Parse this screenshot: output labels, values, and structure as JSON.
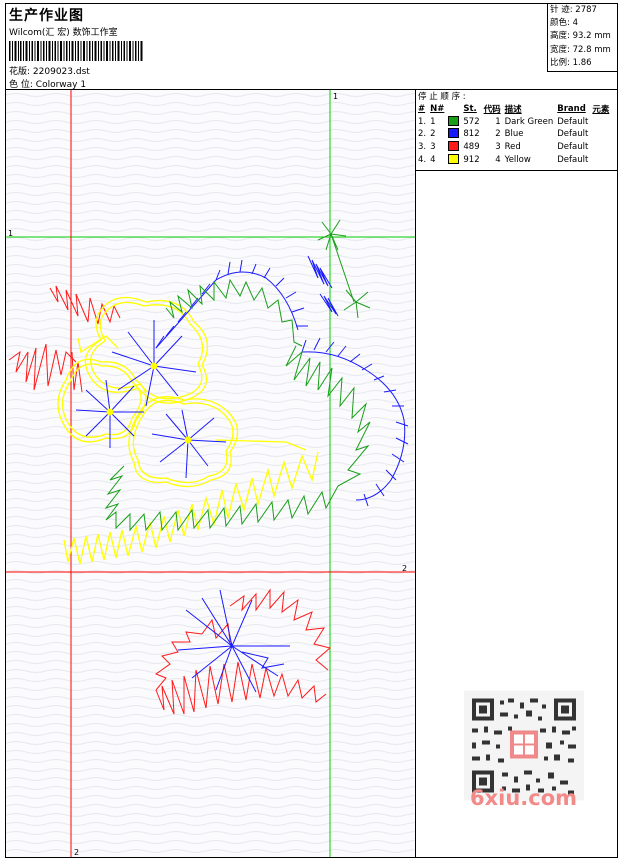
{
  "header": {
    "title": "生产作业图",
    "company": "Wilcom(汇 宏) 数饰工作室",
    "file_label": "花版",
    "file_value": "2209023.dst",
    "colorway_label": "色 位",
    "colorway_value": "Colorway 1"
  },
  "stats": [
    {
      "label": "针 迹",
      "value": "2787"
    },
    {
      "label": "颜色",
      "value": "4"
    },
    {
      "label": "高度",
      "value": "93.2 mm"
    },
    {
      "label": "宽度",
      "value": "72.8 mm"
    },
    {
      "label": "比例",
      "value": "1.86"
    }
  ],
  "stop_table": {
    "caption": "停 止 顺 序 :",
    "headers": [
      "#",
      "N#",
      "St.",
      "代码",
      "描述",
      "Brand",
      "元素"
    ],
    "rows": [
      {
        "num": "1.",
        "n": "1",
        "color": "#1a9e1a",
        "st": "572",
        "code": "1",
        "desc": "Dark Green",
        "brand": "Default"
      },
      {
        "num": "2.",
        "n": "2",
        "color": "#1a1aff",
        "st": "812",
        "code": "2",
        "desc": "Blue",
        "brand": "Default"
      },
      {
        "num": "3.",
        "n": "3",
        "color": "#ff1a1a",
        "st": "489",
        "code": "3",
        "desc": "Red",
        "brand": "Default"
      },
      {
        "num": "4.",
        "n": "4",
        "color": "#ffff00",
        "st": "912",
        "code": "4",
        "desc": "Yellow",
        "brand": "Default"
      }
    ]
  },
  "guides": {
    "v1": "1",
    "h1": "1",
    "h2": "2",
    "v2": "2"
  },
  "watermark": {
    "text": "6xiu.com"
  },
  "colors": {
    "green": "#1a9e1a",
    "blue": "#1a1aff",
    "red": "#ff1a1a",
    "yellow": "#ffff00",
    "guide_green": "#00cc00",
    "guide_red": "#ff0000"
  }
}
